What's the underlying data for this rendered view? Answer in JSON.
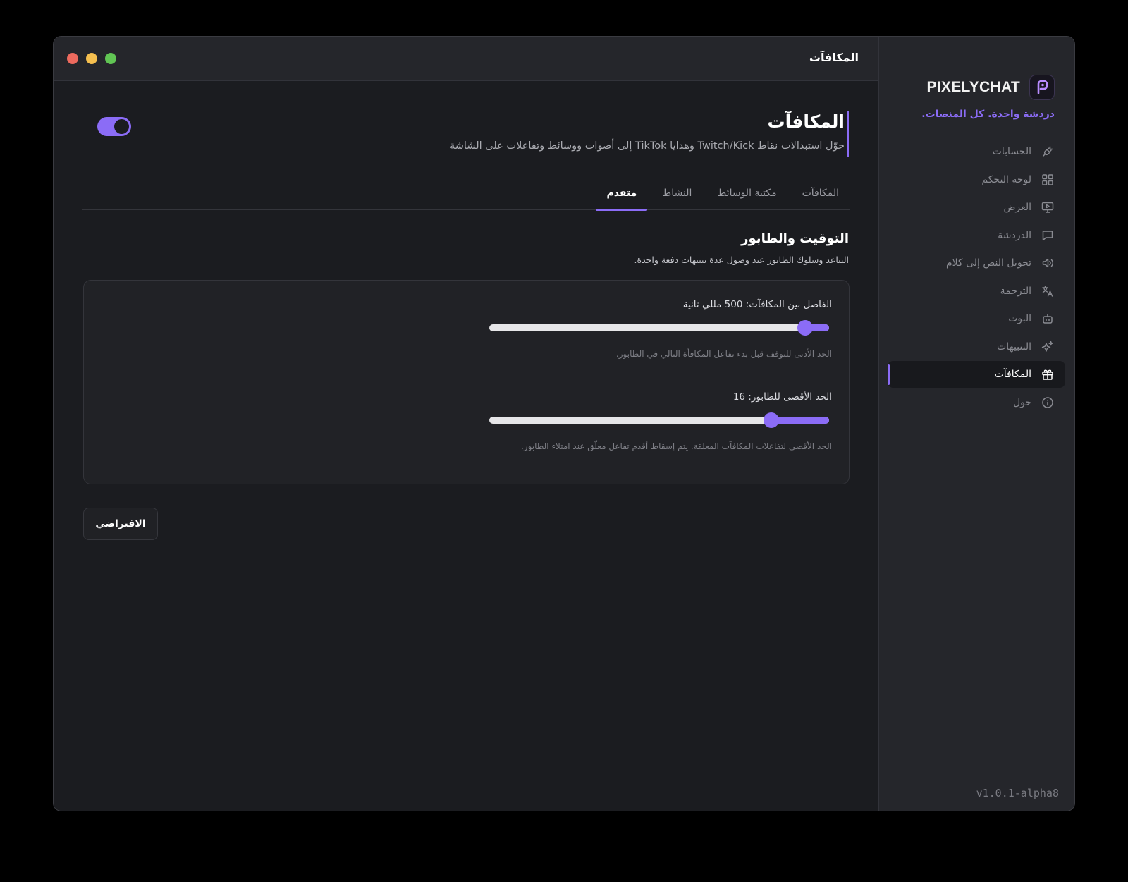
{
  "window": {
    "title": "المكافآت",
    "traffic_lights": {
      "close": "#ed6a5e",
      "minimize": "#f5bf4f",
      "maximize": "#61c554"
    }
  },
  "sidebar": {
    "brand_name": "PIXELYCHAT",
    "tagline": "دردشة واحدة. كل المنصات.",
    "accent_color": "#8b6cf6",
    "items": [
      {
        "label": "الحسابات",
        "icon": "plug-icon",
        "active": false
      },
      {
        "label": "لوحة التحكم",
        "icon": "grid-icon",
        "active": false
      },
      {
        "label": "العرض",
        "icon": "monitor-play-icon",
        "active": false
      },
      {
        "label": "الدردشة",
        "icon": "chat-icon",
        "active": false
      },
      {
        "label": "تحويل النص إلى كلام",
        "icon": "speaker-icon",
        "active": false
      },
      {
        "label": "الترجمة",
        "icon": "translate-icon",
        "active": false
      },
      {
        "label": "البوت",
        "icon": "bot-icon",
        "active": false
      },
      {
        "label": "التنبيهات",
        "icon": "sparkles-icon",
        "active": false
      },
      {
        "label": "المكافآت",
        "icon": "gift-icon",
        "active": true
      },
      {
        "label": "حول",
        "icon": "info-icon",
        "active": false
      }
    ],
    "version": "v1.0.1-alpha8"
  },
  "header": {
    "title": "المكافآت",
    "subtitle": "حوّل استبدالات نقاط Twitch/Kick وهدايا TikTok إلى أصوات ووسائط وتفاعلات على الشاشة",
    "enabled": true
  },
  "tabs": [
    {
      "label": "المكافآت",
      "active": false
    },
    {
      "label": "مكتبة الوسائط",
      "active": false
    },
    {
      "label": "النشاط",
      "active": false
    },
    {
      "label": "متقدم",
      "active": true
    }
  ],
  "section": {
    "title": "التوقيت والطابور",
    "description": "التباعد وسلوك الطابور عند وصول عدة تنبيهات دفعة واحدة."
  },
  "sliders": {
    "interval": {
      "label": "الفاصل بين المكافآت: 500 مللي ثانية",
      "value_fraction": 0.07,
      "help": "الحد الأدنى للتوقف قبل بدء تفاعل المكافأة التالي في الطابور."
    },
    "queue": {
      "label": "الحد الأقصى للطابور: 16",
      "value_fraction": 0.17,
      "help": "الحد الأقصى لتفاعلات المكافآت المعلقة. يتم إسقاط أقدم تفاعل معلّق عند امتلاء الطابور."
    }
  },
  "buttons": {
    "default_label": "الافتراضي"
  }
}
